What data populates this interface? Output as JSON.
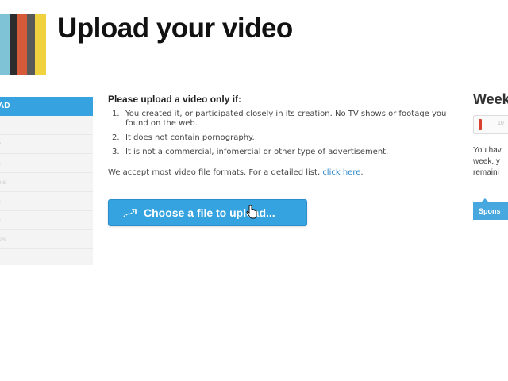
{
  "header": {
    "title": "Upload your video",
    "logo_colors": [
      "#7fc3d6",
      "#2d2d2d",
      "#d65b3a",
      "#595959",
      "#f0d23e"
    ]
  },
  "sidebar": {
    "active_label": "AD",
    "items": [
      "",
      "y",
      "s",
      "els",
      "s",
      "s",
      "sts"
    ]
  },
  "main": {
    "intro": "Please upload a video only if:",
    "rules": [
      {
        "num": "1.",
        "text": "You created it, or participated closely in its creation. No TV shows or footage you found on the web."
      },
      {
        "num": "2.",
        "text": "It does not contain pornography."
      },
      {
        "num": "3.",
        "text": "It is not a commercial, infomercial or other type of advertisement."
      }
    ],
    "formats_text": "We accept most video file formats. For a detailed list, ",
    "formats_link": "click here",
    "formats_end": ".",
    "upload_button": "Choose a file to upload..."
  },
  "right_panel": {
    "title": "Week",
    "meter_value": "10",
    "text_lines": [
      "You hav",
      "week, y",
      "remaini"
    ],
    "sponsor_label": "Spons"
  },
  "colors": {
    "accent": "#34a3df",
    "link": "#2a85c8"
  }
}
